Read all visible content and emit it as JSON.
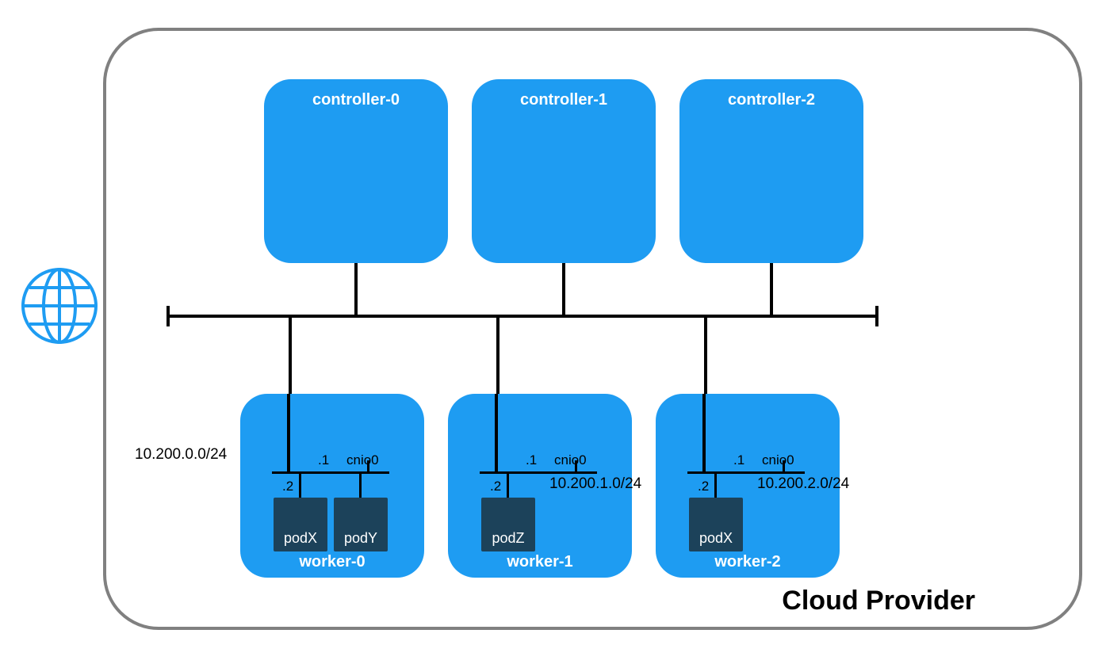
{
  "diagram": {
    "cloud_provider_label": "Cloud Provider",
    "controllers": [
      {
        "name": "controller-0"
      },
      {
        "name": "controller-1"
      },
      {
        "name": "controller-2"
      }
    ],
    "workers": [
      {
        "name": "worker-0",
        "cidr": "10.200.0.0/24",
        "cidr_side": "left",
        "gateway_octet": ".1",
        "bridge": "cnio0",
        "pods": [
          {
            "name": "podX",
            "octet": ".2"
          },
          {
            "name": "podY",
            "octet": null
          }
        ]
      },
      {
        "name": "worker-1",
        "cidr": "10.200.1.0/24",
        "cidr_side": "right",
        "gateway_octet": ".1",
        "bridge": "cnio0",
        "pods": [
          {
            "name": "podZ",
            "octet": ".2"
          }
        ]
      },
      {
        "name": "worker-2",
        "cidr": "10.200.2.0/24",
        "cidr_side": "right",
        "gateway_octet": ".1",
        "bridge": "cnio0",
        "pods": [
          {
            "name": "podX",
            "octet": ".2"
          }
        ]
      }
    ]
  }
}
